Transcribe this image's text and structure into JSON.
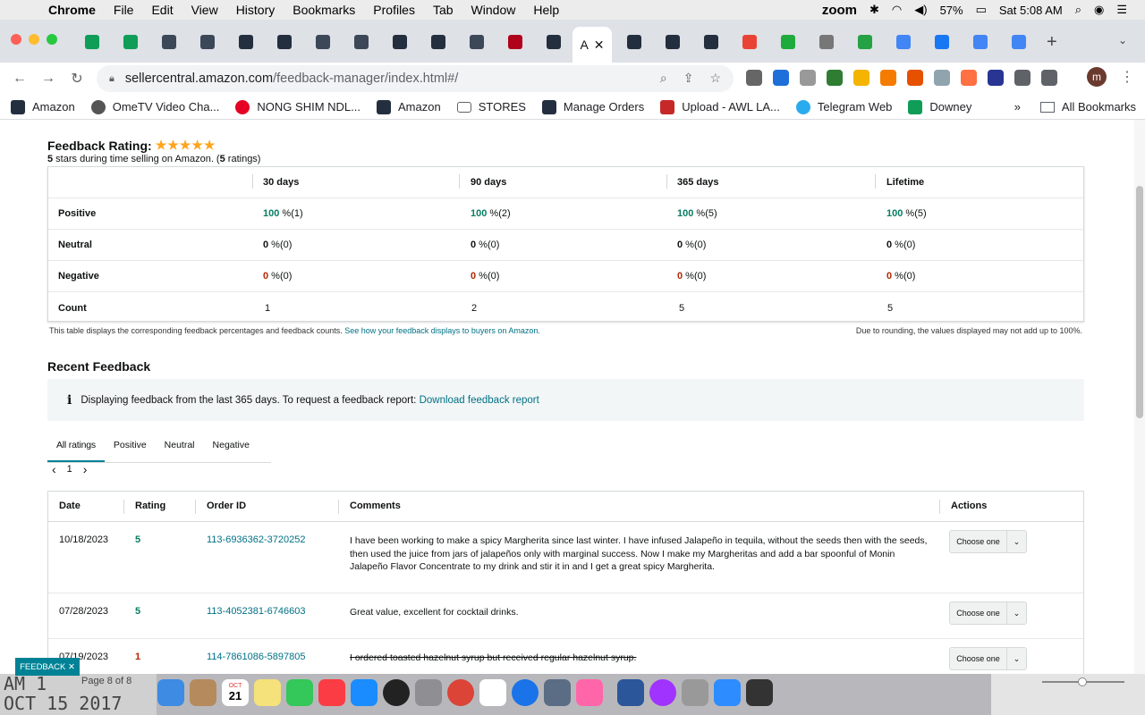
{
  "menubar": {
    "app": "Chrome",
    "items": [
      "File",
      "Edit",
      "View",
      "History",
      "Bookmarks",
      "Profiles",
      "Tab",
      "Window",
      "Help"
    ],
    "zoom": "zoom",
    "battery": "57%",
    "time": "Sat 5:08 AM"
  },
  "browser": {
    "active_tab_label": "A",
    "url_host": "sellercentral.amazon.com",
    "url_path": "/feedback-manager/index.html#/"
  },
  "bookmarks": {
    "items": [
      "Amazon",
      "OmeTV Video Cha...",
      "NONG SHIM NDL...",
      "Amazon",
      "STORES",
      "Manage Orders",
      "Upload - AWL LA...",
      "Telegram Web",
      "Downey"
    ],
    "overflow": "»",
    "all": "All Bookmarks"
  },
  "rating": {
    "title": "Feedback Rating:",
    "stars": "★★★★★",
    "sub_num": "5",
    "sub_mid": " stars during time selling on Amazon. (",
    "sub_count": "5",
    "sub_end": " ratings)"
  },
  "feedback_table": {
    "headers": [
      "30 days",
      "90 days",
      "365 days",
      "Lifetime"
    ],
    "rows": [
      {
        "label": "Positive",
        "cells": [
          [
            "100",
            " %(1)"
          ],
          [
            "100",
            " %(2)"
          ],
          [
            "100",
            " %(5)"
          ],
          [
            "100",
            " %(5)"
          ]
        ]
      },
      {
        "label": "Neutral",
        "cells": [
          [
            "0",
            " %(0)"
          ],
          [
            "0",
            " %(0)"
          ],
          [
            "0",
            " %(0)"
          ],
          [
            "0",
            " %(0)"
          ]
        ]
      },
      {
        "label": "Negative",
        "cells": [
          [
            "0",
            " %(0)"
          ],
          [
            "0",
            " %(0)"
          ],
          [
            "0",
            " %(0)"
          ],
          [
            "0",
            " %(0)"
          ]
        ]
      },
      {
        "label": "Count",
        "cells": [
          [
            "",
            "1"
          ],
          [
            "",
            "2"
          ],
          [
            "",
            "5"
          ],
          [
            "",
            "5"
          ]
        ]
      }
    ],
    "note_left": "This table displays the corresponding feedback percentages and feedback counts.",
    "note_link": "See how your feedback displays to buyers on Amazon.",
    "note_right": "Due to rounding, the values displayed may not add up to 100%."
  },
  "recent": {
    "title": "Recent Feedback",
    "info_icon": "i",
    "info_text": "Displaying feedback from the last 365 days. To request a feedback report:",
    "info_link": "Download feedback report",
    "tabs": [
      "All ratings",
      "Positive",
      "Neutral",
      "Negative"
    ],
    "pager_prev": "‹",
    "pager_page": "1",
    "pager_next": "›",
    "headers": [
      "Date",
      "Rating",
      "Order ID",
      "Comments",
      "Actions"
    ],
    "rows": [
      {
        "date": "10/18/2023",
        "rating": "5",
        "order": "113-6936362-3720252",
        "comment": "I have been working to make a spicy Margherita since last winter. I have infused Jalapeño in tequila, without the seeds then with the seeds, then used the juice from jars of jalapeños only with marginal success. Now I make my Margheritas and add a bar spoonful of Monin Jalapeño Flavor Concentrate to my drink and stir it in and I get a great spicy Margherita.",
        "action": "Choose one"
      },
      {
        "date": "07/28/2023",
        "rating": "5",
        "order": "113-4052381-6746603",
        "comment": "Great value, excellent for cocktail drinks.",
        "action": "Choose one"
      },
      {
        "date": "07/19/2023",
        "rating": "1",
        "order": "114-7861086-5897805",
        "comment": "I ordered toasted hazelnut syrup but received regular hazelnut syrup.",
        "action": "Choose one"
      }
    ]
  },
  "feedback_tag": "FEEDBACK ✕",
  "dock": {
    "left_text_1": "AM 1",
    "left_text_2": "OCT 15 2017",
    "page_label": "Page 8 of 8",
    "calendar_month": "OCT",
    "calendar_day": "21"
  },
  "colors": {
    "accent": "#007185",
    "positive": "#067d62",
    "negative": "#b12704",
    "star": "#ffa41c",
    "teal": "#008296"
  }
}
